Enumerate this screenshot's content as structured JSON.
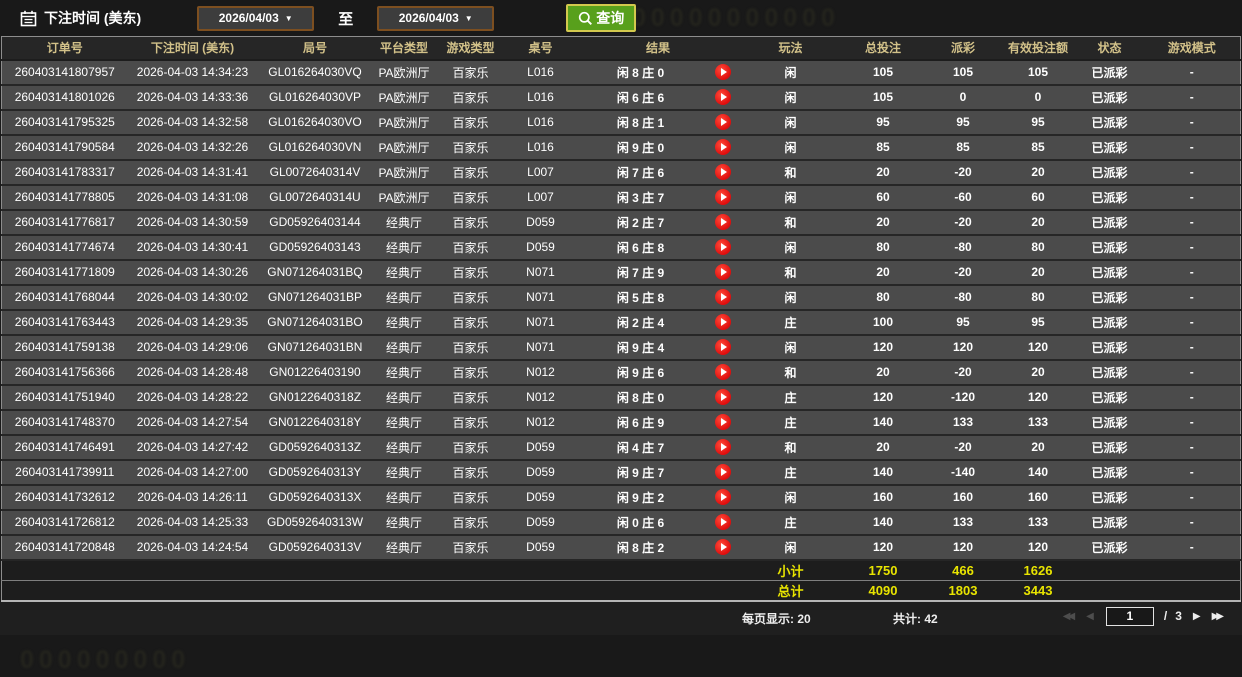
{
  "toolbar": {
    "title": "下注时间 (美东)",
    "start_date": "2026/04/03",
    "end_date": "2026/04/03",
    "to_label": "至",
    "query_label": "查询"
  },
  "icons": {
    "calendar": "calendar-outline",
    "search": "magnifier",
    "caret": "▼",
    "play": "▶",
    "first_page": "◀◀",
    "prev_page": "◀",
    "next_page": "▶",
    "last_page": "▶▶"
  },
  "colors": {
    "header_text": "#d2c189",
    "payout_positive": "#c0273e",
    "payout_negative": "#9ac832",
    "status_green": "#2ed32e",
    "summary_yellow": "#e8e400",
    "query_button_bg": "#58a01c",
    "query_button_border": "#d3c94e",
    "play_icon_red": "#e00d0d"
  },
  "table": {
    "headers": [
      "订单号",
      "下注时间 (美东)",
      "局号",
      "平台类型",
      "游戏类型",
      "桌号",
      "结果",
      "玩法",
      "总投注",
      "派彩",
      "有效投注额",
      "状态",
      "游戏模式"
    ]
  },
  "rows": [
    {
      "order": "260403141807957",
      "time": "2026-04-03 14:34:23",
      "round": "GL016264030VQ",
      "platform": "PA欧洲厅",
      "game": "百家乐",
      "table": "L016",
      "result": "闲 8 庄 0",
      "play": "闲",
      "bet": "105",
      "payout": "105",
      "payout_tone": "win",
      "valid": "105",
      "status": "已派彩",
      "mode": "-"
    },
    {
      "order": "260403141801026",
      "time": "2026-04-03 14:33:36",
      "round": "GL016264030VP",
      "platform": "PA欧洲厅",
      "game": "百家乐",
      "table": "L016",
      "result": "闲 6 庄 6",
      "play": "闲",
      "bet": "105",
      "payout": "0",
      "payout_tone": "zero",
      "valid": "0",
      "status": "已派彩",
      "mode": "-"
    },
    {
      "order": "260403141795325",
      "time": "2026-04-03 14:32:58",
      "round": "GL016264030VO",
      "platform": "PA欧洲厅",
      "game": "百家乐",
      "table": "L016",
      "result": "闲 8 庄 1",
      "play": "闲",
      "bet": "95",
      "payout": "95",
      "payout_tone": "win",
      "valid": "95",
      "status": "已派彩",
      "mode": "-"
    },
    {
      "order": "260403141790584",
      "time": "2026-04-03 14:32:26",
      "round": "GL016264030VN",
      "platform": "PA欧洲厅",
      "game": "百家乐",
      "table": "L016",
      "result": "闲 9 庄 0",
      "play": "闲",
      "bet": "85",
      "payout": "85",
      "payout_tone": "win",
      "valid": "85",
      "status": "已派彩",
      "mode": "-"
    },
    {
      "order": "260403141783317",
      "time": "2026-04-03 14:31:41",
      "round": "GL0072640314V",
      "platform": "PA欧洲厅",
      "game": "百家乐",
      "table": "L007",
      "result": "闲 7 庄 6",
      "play": "和",
      "bet": "20",
      "payout": "-20",
      "payout_tone": "lose",
      "valid": "20",
      "status": "已派彩",
      "mode": "-"
    },
    {
      "order": "260403141778805",
      "time": "2026-04-03 14:31:08",
      "round": "GL0072640314U",
      "platform": "PA欧洲厅",
      "game": "百家乐",
      "table": "L007",
      "result": "闲 3 庄 7",
      "play": "闲",
      "bet": "60",
      "payout": "-60",
      "payout_tone": "lose",
      "valid": "60",
      "status": "已派彩",
      "mode": "-"
    },
    {
      "order": "260403141776817",
      "time": "2026-04-03 14:30:59",
      "round": "GD05926403144",
      "platform": "经典厅",
      "game": "百家乐",
      "table": "D059",
      "result": "闲 2 庄 7",
      "play": "和",
      "bet": "20",
      "payout": "-20",
      "payout_tone": "lose",
      "valid": "20",
      "status": "已派彩",
      "mode": "-"
    },
    {
      "order": "260403141774674",
      "time": "2026-04-03 14:30:41",
      "round": "GD05926403143",
      "platform": "经典厅",
      "game": "百家乐",
      "table": "D059",
      "result": "闲 6 庄 8",
      "play": "闲",
      "bet": "80",
      "payout": "-80",
      "payout_tone": "lose",
      "valid": "80",
      "status": "已派彩",
      "mode": "-"
    },
    {
      "order": "260403141771809",
      "time": "2026-04-03 14:30:26",
      "round": "GN071264031BQ",
      "platform": "经典厅",
      "game": "百家乐",
      "table": "N071",
      "result": "闲 7 庄 9",
      "play": "和",
      "bet": "20",
      "payout": "-20",
      "payout_tone": "lose",
      "valid": "20",
      "status": "已派彩",
      "mode": "-"
    },
    {
      "order": "260403141768044",
      "time": "2026-04-03 14:30:02",
      "round": "GN071264031BP",
      "platform": "经典厅",
      "game": "百家乐",
      "table": "N071",
      "result": "闲 5 庄 8",
      "play": "闲",
      "bet": "80",
      "payout": "-80",
      "payout_tone": "lose",
      "valid": "80",
      "status": "已派彩",
      "mode": "-"
    },
    {
      "order": "260403141763443",
      "time": "2026-04-03 14:29:35",
      "round": "GN071264031BO",
      "platform": "经典厅",
      "game": "百家乐",
      "table": "N071",
      "result": "闲 2 庄 4",
      "play": "庄",
      "bet": "100",
      "payout": "95",
      "payout_tone": "win",
      "valid": "95",
      "status": "已派彩",
      "mode": "-"
    },
    {
      "order": "260403141759138",
      "time": "2026-04-03 14:29:06",
      "round": "GN071264031BN",
      "platform": "经典厅",
      "game": "百家乐",
      "table": "N071",
      "result": "闲 9 庄 4",
      "play": "闲",
      "bet": "120",
      "payout": "120",
      "payout_tone": "win",
      "valid": "120",
      "status": "已派彩",
      "mode": "-"
    },
    {
      "order": "260403141756366",
      "time": "2026-04-03 14:28:48",
      "round": "GN01226403190",
      "platform": "经典厅",
      "game": "百家乐",
      "table": "N012",
      "result": "闲 9 庄 6",
      "play": "和",
      "bet": "20",
      "payout": "-20",
      "payout_tone": "lose",
      "valid": "20",
      "status": "已派彩",
      "mode": "-"
    },
    {
      "order": "260403141751940",
      "time": "2026-04-03 14:28:22",
      "round": "GN0122640318Z",
      "platform": "经典厅",
      "game": "百家乐",
      "table": "N012",
      "result": "闲 8 庄 0",
      "play": "庄",
      "bet": "120",
      "payout": "-120",
      "payout_tone": "lose",
      "valid": "120",
      "status": "已派彩",
      "mode": "-"
    },
    {
      "order": "260403141748370",
      "time": "2026-04-03 14:27:54",
      "round": "GN0122640318Y",
      "platform": "经典厅",
      "game": "百家乐",
      "table": "N012",
      "result": "闲 6 庄 9",
      "play": "庄",
      "bet": "140",
      "payout": "133",
      "payout_tone": "win",
      "valid": "133",
      "status": "已派彩",
      "mode": "-"
    },
    {
      "order": "260403141746491",
      "time": "2026-04-03 14:27:42",
      "round": "GD0592640313Z",
      "platform": "经典厅",
      "game": "百家乐",
      "table": "D059",
      "result": "闲 4 庄 7",
      "play": "和",
      "bet": "20",
      "payout": "-20",
      "payout_tone": "lose",
      "valid": "20",
      "status": "已派彩",
      "mode": "-"
    },
    {
      "order": "260403141739911",
      "time": "2026-04-03 14:27:00",
      "round": "GD0592640313Y",
      "platform": "经典厅",
      "game": "百家乐",
      "table": "D059",
      "result": "闲 9 庄 7",
      "play": "庄",
      "bet": "140",
      "payout": "-140",
      "payout_tone": "lose",
      "valid": "140",
      "status": "已派彩",
      "mode": "-"
    },
    {
      "order": "260403141732612",
      "time": "2026-04-03 14:26:11",
      "round": "GD0592640313X",
      "platform": "经典厅",
      "game": "百家乐",
      "table": "D059",
      "result": "闲 9 庄 2",
      "play": "闲",
      "bet": "160",
      "payout": "160",
      "payout_tone": "win",
      "valid": "160",
      "status": "已派彩",
      "mode": "-"
    },
    {
      "order": "260403141726812",
      "time": "2026-04-03 14:25:33",
      "round": "GD0592640313W",
      "platform": "经典厅",
      "game": "百家乐",
      "table": "D059",
      "result": "闲 0 庄 6",
      "play": "庄",
      "bet": "140",
      "payout": "133",
      "payout_tone": "win",
      "valid": "133",
      "status": "已派彩",
      "mode": "-"
    },
    {
      "order": "260403141720848",
      "time": "2026-04-03 14:24:54",
      "round": "GD0592640313V",
      "platform": "经典厅",
      "game": "百家乐",
      "table": "D059",
      "result": "闲 8 庄 2",
      "play": "闲",
      "bet": "120",
      "payout": "120",
      "payout_tone": "win",
      "valid": "120",
      "status": "已派彩",
      "mode": "-"
    }
  ],
  "summary": {
    "subtotal_label": "小计",
    "subtotal": {
      "total_bet": "1750",
      "payout": "466",
      "valid_bet": "1626"
    },
    "total_label": "总计",
    "total": {
      "total_bet": "4090",
      "payout": "1803",
      "valid_bet": "3443"
    }
  },
  "footer": {
    "per_page_label": "每页显示: 20",
    "total_count_label": "共计: 42",
    "page_input_value": "1",
    "page_separator": "/",
    "total_pages": "3"
  }
}
